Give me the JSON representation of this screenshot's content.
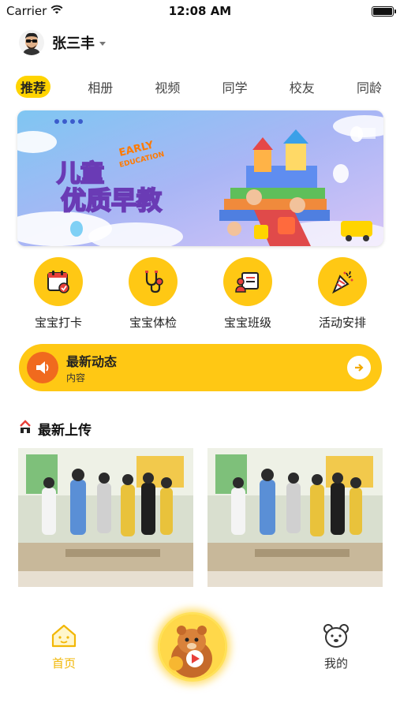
{
  "status_bar": {
    "carrier": "Carrier",
    "time": "12:08 AM"
  },
  "user": {
    "name": "张三丰"
  },
  "tabs": [
    {
      "label": "推荐",
      "active": true
    },
    {
      "label": "相册",
      "active": false
    },
    {
      "label": "视频",
      "active": false
    },
    {
      "label": "同学",
      "active": false
    },
    {
      "label": "校友",
      "active": false
    },
    {
      "label": "同龄",
      "active": false
    }
  ],
  "quick_menu": [
    {
      "label": "宝宝打卡",
      "icon": "calendar-check-icon"
    },
    {
      "label": "宝宝体检",
      "icon": "stethoscope-icon"
    },
    {
      "label": "宝宝班级",
      "icon": "class-board-icon"
    },
    {
      "label": "活动安排",
      "icon": "party-popper-icon"
    }
  ],
  "news": {
    "title": "最新动态",
    "subtitle": "内容"
  },
  "latest_upload": {
    "title": "最新上传"
  },
  "bottom_nav": {
    "home_label": "首页",
    "mine_label": "我的"
  },
  "colors": {
    "accent": "#ffc814",
    "tab_active": "#ffd400",
    "news_icon_bg": "#f06a1e",
    "home_label": "#f2b705"
  }
}
